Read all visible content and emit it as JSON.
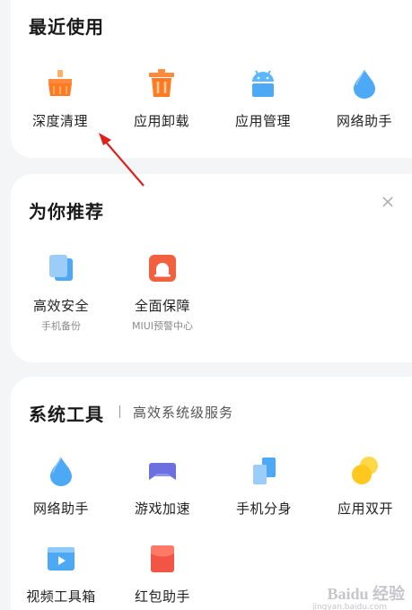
{
  "recent": {
    "title": "最近使用",
    "items": [
      {
        "label": "深度清理",
        "icon": "broom-icon"
      },
      {
        "label": "应用卸载",
        "icon": "trash-icon"
      },
      {
        "label": "应用管理",
        "icon": "android-icon"
      },
      {
        "label": "网络助手",
        "icon": "water-drop-icon"
      }
    ]
  },
  "recommend": {
    "title": "为你推荐",
    "items": [
      {
        "label": "高效安全",
        "sub": "手机备份",
        "icon": "backup-icon"
      },
      {
        "label": "全面保障",
        "sub": "MIUI预警中心",
        "icon": "alarm-icon"
      }
    ]
  },
  "tools": {
    "title": "系统工具",
    "subtitle": "高效系统级服务",
    "items": [
      {
        "label": "网络助手",
        "icon": "water-drop-icon"
      },
      {
        "label": "游戏加速",
        "icon": "gamepad-icon"
      },
      {
        "label": "手机分身",
        "icon": "dual-phone-icon"
      },
      {
        "label": "应用双开",
        "icon": "dual-circle-icon"
      },
      {
        "label": "视频工具箱",
        "icon": "video-icon"
      },
      {
        "label": "红包助手",
        "icon": "red-envelope-icon"
      }
    ]
  },
  "watermark": {
    "line1": "Baidu 经验",
    "line2": "jingyan.baidu.com"
  },
  "colors": {
    "orange": "#ff8a3d",
    "blue": "#4da8f5",
    "red": "#f25545",
    "purple": "#6b6fe0",
    "yellow": "#ffc81e"
  }
}
